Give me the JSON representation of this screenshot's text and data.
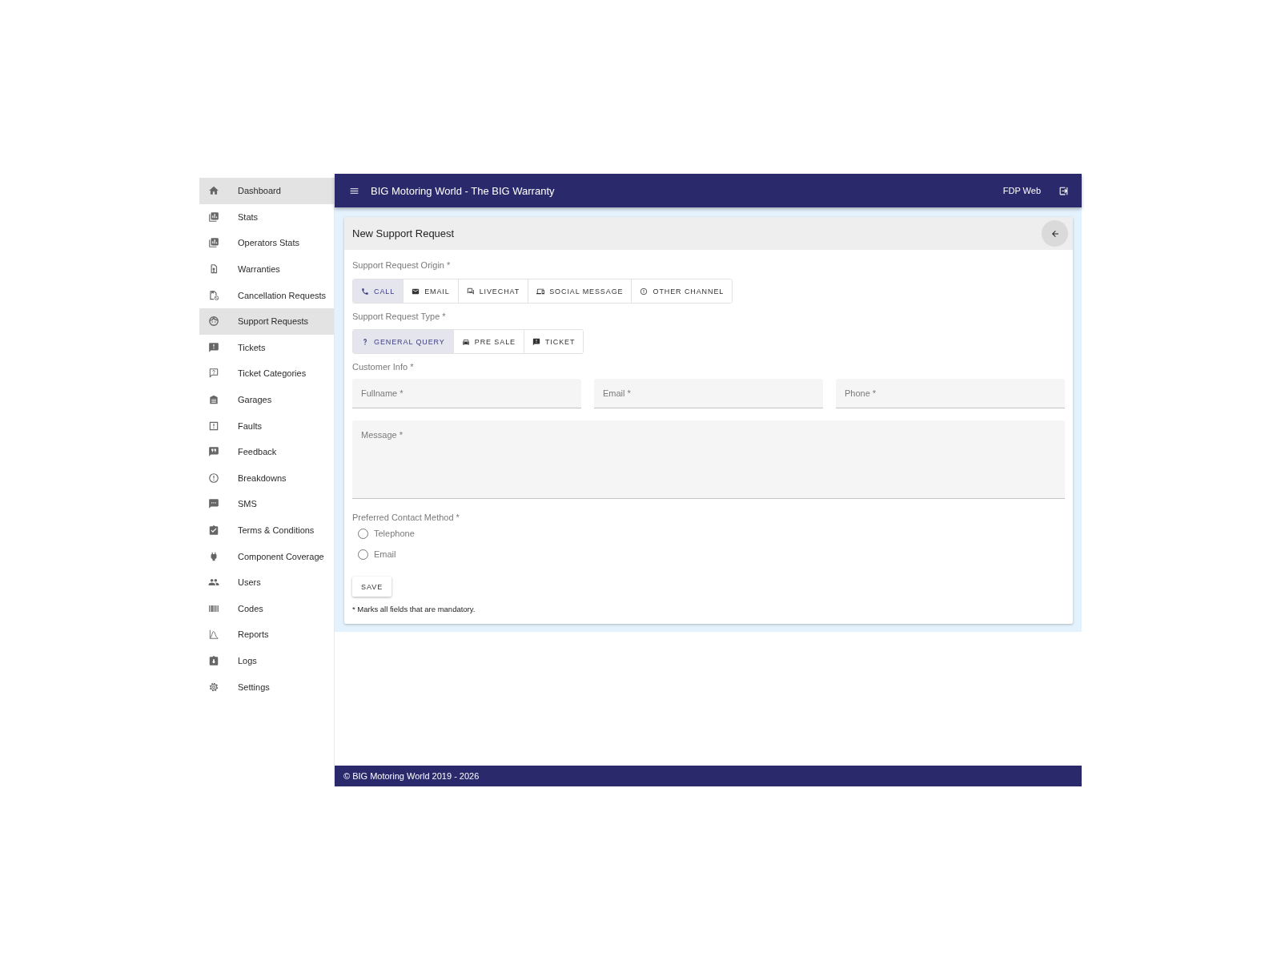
{
  "sidebar": {
    "items": [
      {
        "label": "Dashboard",
        "selected": true
      },
      {
        "label": "Stats",
        "selected": false
      },
      {
        "label": "Operators Stats",
        "selected": false
      },
      {
        "label": "Warranties",
        "selected": false
      },
      {
        "label": "Cancellation Requests",
        "selected": false
      },
      {
        "label": "Support Requests",
        "selected": true
      },
      {
        "label": "Tickets",
        "selected": false
      },
      {
        "label": "Ticket Categories",
        "selected": false
      },
      {
        "label": "Garages",
        "selected": false
      },
      {
        "label": "Faults",
        "selected": false
      },
      {
        "label": "Feedback",
        "selected": false
      },
      {
        "label": "Breakdowns",
        "selected": false
      },
      {
        "label": "SMS",
        "selected": false
      },
      {
        "label": "Terms & Conditions",
        "selected": false
      },
      {
        "label": "Component Coverage",
        "selected": false
      },
      {
        "label": "Users",
        "selected": false
      },
      {
        "label": "Codes",
        "selected": false
      },
      {
        "label": "Reports",
        "selected": false
      },
      {
        "label": "Logs",
        "selected": false
      },
      {
        "label": "Settings",
        "selected": false
      }
    ]
  },
  "app_bar": {
    "title": "BIG Motoring World - The BIG Warranty",
    "user": "FDP Web"
  },
  "card": {
    "title": "New Support Request",
    "origin": {
      "label": "Support Request Origin *",
      "options": [
        {
          "label": "CALL",
          "selected": true
        },
        {
          "label": "EMAIL",
          "selected": false
        },
        {
          "label": "LIVECHAT",
          "selected": false
        },
        {
          "label": "SOCIAL MESSAGE",
          "selected": false
        },
        {
          "label": "OTHER CHANNEL",
          "selected": false
        }
      ]
    },
    "type": {
      "label": "Support Request Type *",
      "options": [
        {
          "label": "GENERAL QUERY",
          "selected": true
        },
        {
          "label": "PRE SALE",
          "selected": false
        },
        {
          "label": "TICKET",
          "selected": false
        }
      ]
    },
    "customer_info": {
      "label": "Customer Info *",
      "fields": [
        {
          "placeholder": "Fullname *"
        },
        {
          "placeholder": "Email *"
        },
        {
          "placeholder": "Phone *"
        }
      ]
    },
    "message": {
      "placeholder": "Message *"
    },
    "contact_method": {
      "label": "Preferred Contact Method *",
      "options": [
        {
          "label": "Telephone",
          "selected": false
        },
        {
          "label": "Email",
          "selected": false
        }
      ]
    },
    "save_button": "SAVE",
    "note": "* Marks all fields that are mandatory."
  },
  "footer": "© BIG Motoring World 2019 - 2026"
}
